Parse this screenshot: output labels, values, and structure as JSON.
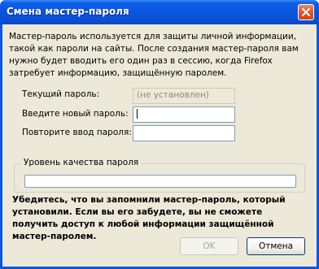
{
  "window": {
    "title": "Смена мастер-пароля"
  },
  "intro_text": "Мастер-пароль используется для защиты личной информации, такой как пароли на сайты. После создания мастер-пароля вам нужно будет вводить его один раз в сессию, когда Firefox затребует информацию, защищённую паролем.",
  "fields": {
    "current_label": "Текущий пароль:",
    "current_value": "(не установлен)",
    "new_label": "Введите новый пароль:",
    "new_value": "",
    "repeat_label": "Повторите ввод пароля:",
    "repeat_value": ""
  },
  "quality": {
    "label": "Уровень качества пароля",
    "level": 0
  },
  "warning_text": "Убедитесь, что вы запомнили мастер-пароль, который установили. Если вы его забудете, вы не сможете получить доступ к любой информации защищённой мастер-паролем.",
  "buttons": {
    "ok": "OK",
    "cancel": "Отмена"
  }
}
